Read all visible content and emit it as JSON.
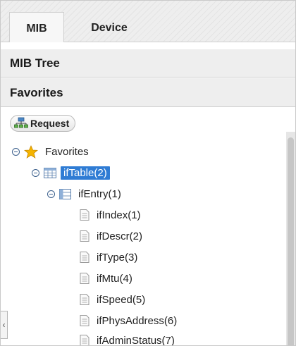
{
  "tabs": [
    {
      "label": "MIB",
      "active": true
    },
    {
      "label": "Device",
      "active": false
    }
  ],
  "accordion": {
    "mib_tree": "MIB Tree",
    "favorites": "Favorites"
  },
  "toolbar": {
    "request_label": "Request",
    "request_icon": "network-icon"
  },
  "tree": {
    "root": {
      "label": "Favorites",
      "icon": "star-icon",
      "expanded": true
    },
    "table": {
      "label": "ifTable(2)",
      "icon": "table-icon",
      "expanded": true,
      "selected": true
    },
    "entry": {
      "label": "ifEntry(1)",
      "icon": "entry-icon",
      "expanded": true
    },
    "leaves": [
      {
        "label": "ifIndex(1)"
      },
      {
        "label": "ifDescr(2)"
      },
      {
        "label": "ifType(3)"
      },
      {
        "label": "ifMtu(4)"
      },
      {
        "label": "ifSpeed(5)"
      },
      {
        "label": "ifPhysAddress(6)"
      },
      {
        "label": "ifAdminStatus(7)"
      }
    ]
  },
  "collapse_glyph": "‹",
  "colors": {
    "selection": "#2f7cd4",
    "header_bg": "#eeeeee",
    "star": "#f5b400"
  }
}
